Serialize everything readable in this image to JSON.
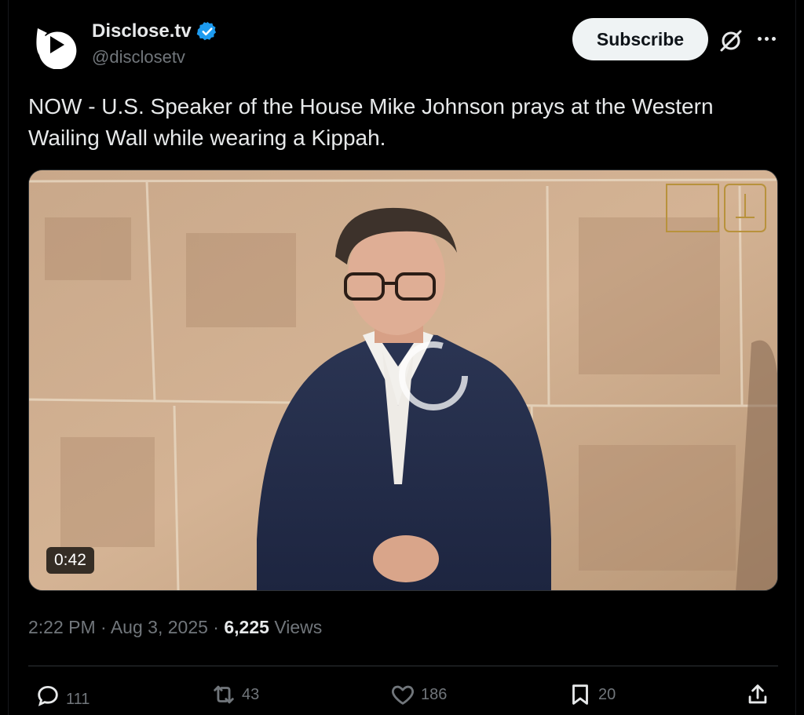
{
  "author": {
    "name": "Disclose.tv",
    "handle": "@disclosetv",
    "avatar_icon": "disclose-logo-icon",
    "verified_icon": "verified-badge-icon",
    "verified_color": "#1d9bf0"
  },
  "header": {
    "subscribe_label": "Subscribe",
    "grok_icon": "grok-icon",
    "more_icon": "more-icon"
  },
  "post": {
    "text": "NOW - U.S. Speaker of the House Mike Johnson prays at the Western Wailing Wall while wearing a Kippah."
  },
  "video": {
    "duration": "0:42",
    "play_icon": "play-icon"
  },
  "meta": {
    "time": "2:22 PM",
    "date": "Aug 3, 2025",
    "views_count": "6,225",
    "views_label": "Views",
    "separator": "·"
  },
  "actions": {
    "replies": "111",
    "reposts": "43",
    "likes": "186",
    "bookmarks": "20"
  },
  "colors": {
    "background": "#000000",
    "text": "#e7e9ea",
    "muted": "#71767b",
    "border": "#2f3336"
  }
}
